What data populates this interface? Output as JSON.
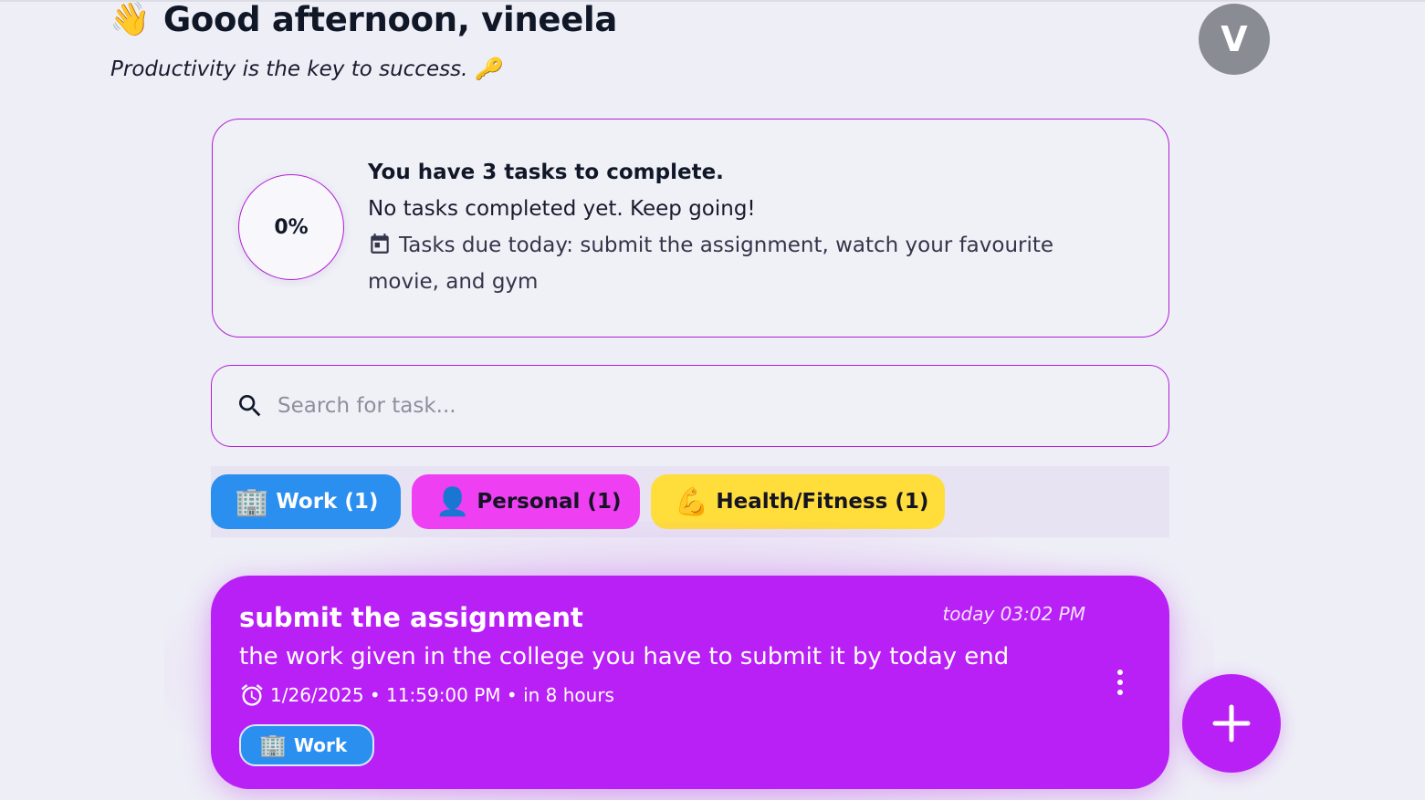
{
  "header": {
    "wave_emoji": "👋",
    "greeting": "Good afternoon, vineela",
    "tagline": "Productivity is the key to success.",
    "tagline_emoji": "🔑",
    "avatar_initial": "V"
  },
  "summary": {
    "progress": "0%",
    "progress_fraction": 0,
    "title": "You have 3 tasks to complete.",
    "status": "No tasks completed yet. Keep going!",
    "due_today": "Tasks due today: submit the assignment, watch your favourite movie, and gym",
    "icon": "calendar-icon"
  },
  "search": {
    "placeholder": "Search for task...",
    "value": "",
    "icon": "search-icon"
  },
  "categories": [
    {
      "emoji": "🏢",
      "label": "Work (1)",
      "color": "#2b8ff0"
    },
    {
      "emoji": "👤",
      "label": "Personal (1)",
      "color": "#ee3ff3"
    },
    {
      "emoji": "💪",
      "label": "Health/Fitness (1)",
      "color": "#ffdd3a"
    }
  ],
  "tasks": [
    {
      "title": "submit the assignment",
      "created": "today 03:02 PM",
      "description": "the work given in the college you have to submit it by today end",
      "deadline": "1/26/2025 • 11:59:00 PM • in 8 hours",
      "category_emoji": "🏢",
      "category": "Work",
      "color": "#b920f5"
    }
  ],
  "fab": {
    "icon": "plus-icon"
  },
  "colors": {
    "accent": "#b920f5",
    "border": "#b11ed8",
    "background": "#eeeef6"
  }
}
